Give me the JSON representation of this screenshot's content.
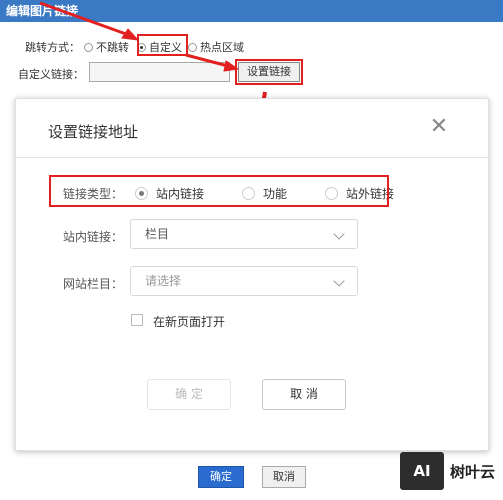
{
  "window": {
    "title": "编辑图片链接"
  },
  "jump": {
    "label": "跳转方式：",
    "options": [
      "不跳转",
      "自定义",
      "热点区域"
    ],
    "selected": "自定义"
  },
  "custom_link": {
    "label": "自定义链接：",
    "value": "",
    "set_button": "设置链接"
  },
  "dialog": {
    "title": "设置链接地址",
    "link_type": {
      "label": "链接类型：",
      "options": [
        "站内链接",
        "功能",
        "站外链接"
      ],
      "selected": "站内链接"
    },
    "internal_link": {
      "label": "站内链接：",
      "value": "栏目"
    },
    "site_column": {
      "label": "网站栏目：",
      "placeholder": "请选择"
    },
    "new_page": {
      "label": "在新页面打开",
      "checked": false
    },
    "confirm_label": "确 定",
    "cancel_label": "取 消"
  },
  "footer": {
    "confirm_label": "确定",
    "cancel_label": "取消"
  },
  "watermark": {
    "logo": "AI",
    "text": "树叶云"
  },
  "colors": {
    "title_bar": "#3a79c4",
    "annotation_red": "#e32020",
    "primary_button": "#2a6bd0"
  }
}
